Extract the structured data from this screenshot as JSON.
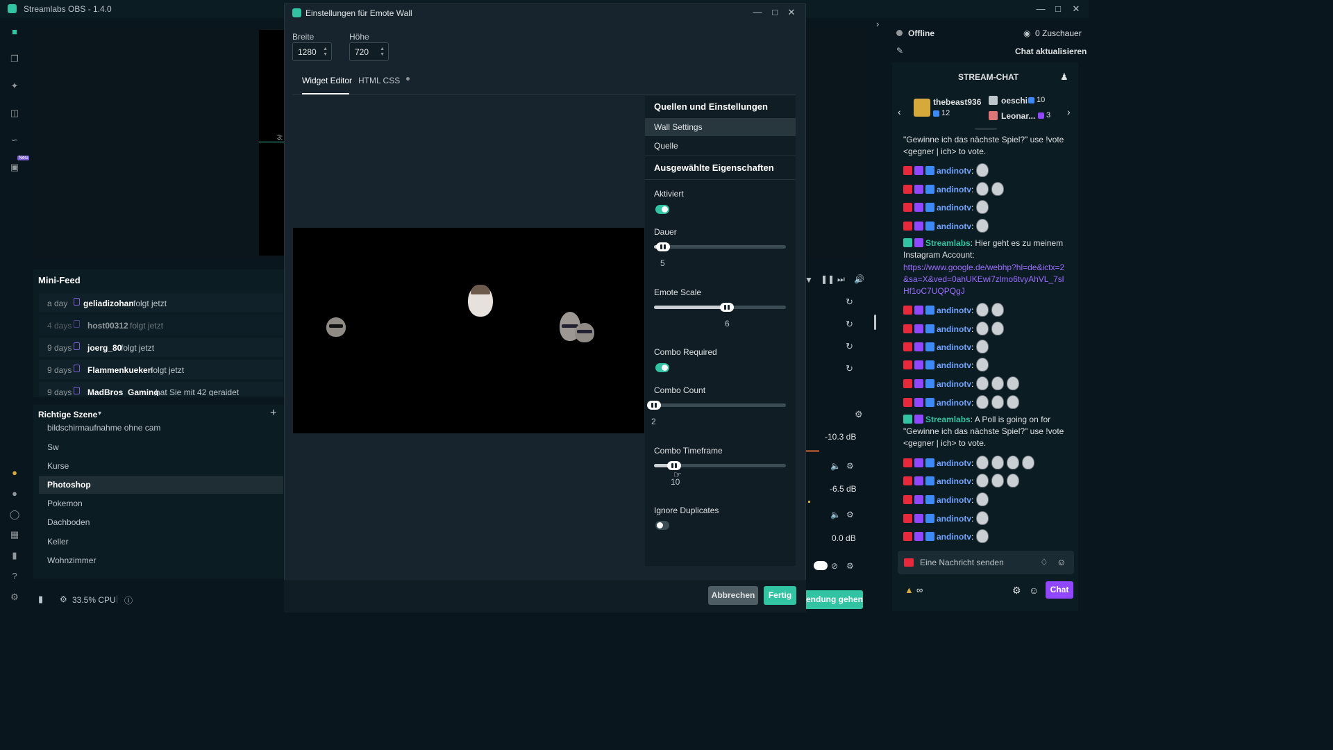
{
  "app": {
    "title": "Streamlabs OBS - 1.4.0"
  },
  "dialog": {
    "title": "Einstellungen für Emote Wall",
    "width_label": "Breite",
    "width_value": "1280",
    "height_label": "Höhe",
    "height_value": "720",
    "tabs": [
      {
        "label": "Widget Editor"
      },
      {
        "label": "HTML CSS"
      }
    ],
    "settings_header": "Quellen und Einstellungen",
    "menu": [
      {
        "label": "Wall Settings"
      },
      {
        "label": "Quelle"
      }
    ],
    "props_header": "Ausgewählte Eigenschaften",
    "props": {
      "enabled": {
        "label": "Aktiviert",
        "on": true
      },
      "duration": {
        "label": "Dauer",
        "value": "5",
        "fraction": 0.07
      },
      "emote_scale": {
        "label": "Emote Scale",
        "value": "6",
        "fraction": 0.55
      },
      "combo_required": {
        "label": "Combo Required",
        "on": true
      },
      "combo_count": {
        "label": "Combo Count",
        "value": "2",
        "fraction": 0.0
      },
      "combo_timeframe": {
        "label": "Combo Timeframe",
        "value": "10",
        "fraction": 0.15
      },
      "ignore_duplicates": {
        "label": "Ignore Duplicates",
        "on": false
      }
    },
    "cancel": "Abbrechen",
    "done": "Fertig"
  },
  "minifeed": {
    "title": "Mini-Feed",
    "items": [
      {
        "time": "a day",
        "name": "geliadizohan",
        "action": "folgt jetzt"
      },
      {
        "time": "4 days",
        "name": "host00312",
        "action": "folgt jetzt"
      },
      {
        "time": "9 days",
        "name": "joerg_80",
        "action": "folgt jetzt"
      },
      {
        "time": "9 days",
        "name": "Flammenkueken",
        "action": "folgt jetzt"
      },
      {
        "time": "9 days",
        "name": "MadBros_Gaming",
        "action": "hat Sie mit 42 geraidet"
      }
    ]
  },
  "scenes": {
    "title": "Richtige Szene",
    "items": [
      {
        "label": "bildschirmaufnahme ohne cam"
      },
      {
        "label": "Sw"
      },
      {
        "label": "Kurse"
      },
      {
        "label": "Photoshop"
      },
      {
        "label": "Pokemon"
      },
      {
        "label": "Dachboden"
      },
      {
        "label": "Keller"
      },
      {
        "label": "Wohnzimmer"
      }
    ]
  },
  "mixer": {
    "db1": "-10.3 dB",
    "db2": "-6.5 dB",
    "db3": "0.0 dB"
  },
  "status": {
    "cpu": "33.5% CPU"
  },
  "go_live": "Sendung gehen",
  "chat": {
    "status": "Offline",
    "viewers": "0 Zuschauer",
    "refresh": "Chat aktualisieren",
    "header": "STREAM-CHAT",
    "gift1": {
      "name": "thebeast936",
      "count": "12"
    },
    "gift2": {
      "name": "oeschi",
      "count": "10"
    },
    "gift3": {
      "name": "Leonar...",
      "count": "3"
    },
    "line_top": "\"Gewinne ich das nächste Spiel?\" use !vote <gegner | ich> to vote.",
    "user": "andinotv",
    "bot": "Streamlabs",
    "msg1": "Hier geht es zu meinem Instagram Account:",
    "link": "https://www.google.de/webhp?hl=de&ictx=2&sa=X&ved=0ahUKEwi7zlmo6tvyAhVL_7slHf1oC7UQPQgJ",
    "msg2": "A Poll is going on for \"Gewinne ich das nächste Spiel?\" use !vote <gegner | ich> to vote.",
    "placeholder": "Eine Nachricht senden",
    "chat_button": "Chat"
  },
  "nav": {
    "new_badge": "Neu"
  },
  "colors": {
    "accent": "#31c3a2",
    "link": "#9b6dff",
    "twitch": "#9146ff"
  }
}
